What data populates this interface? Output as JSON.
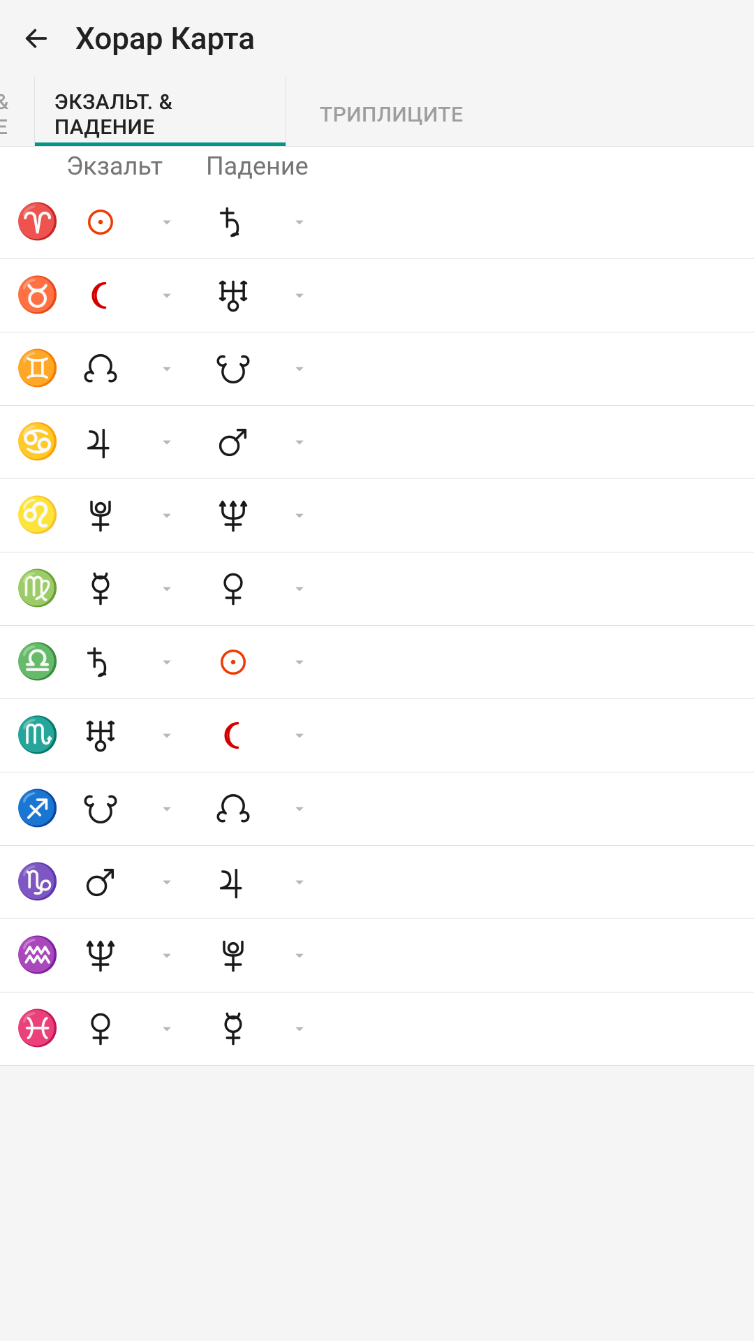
{
  "header": {
    "title": "Хорар Карта"
  },
  "tabs": {
    "left": "ТЕЛЬ &\nНАНИЕ",
    "center": "ЭКЗАЛЬТ. &\nПАДЕНИЕ",
    "right": "ТРИПЛИЦИТЕ"
  },
  "columns": {
    "exalt": "Экзальт",
    "fall": "Падение"
  },
  "rows": [
    {
      "sign": "aries",
      "sign_glyph": "♈",
      "sign_color": "c-red",
      "exalt": "sun",
      "exalt_color": "c-red-sun",
      "fall": "saturn",
      "fall_color": "c-black"
    },
    {
      "sign": "taurus",
      "sign_glyph": "♉",
      "sign_color": "c-green",
      "exalt": "moon",
      "exalt_color": "c-red-bright",
      "fall": "uranus",
      "fall_color": "c-black"
    },
    {
      "sign": "gemini",
      "sign_glyph": "♊",
      "sign_color": "c-blue",
      "exalt": "north-node",
      "exalt_color": "c-black",
      "fall": "south-node",
      "fall_color": "c-black"
    },
    {
      "sign": "cancer",
      "sign_glyph": "♋",
      "sign_color": "c-teal",
      "exalt": "jupiter",
      "exalt_color": "c-black",
      "fall": "mars",
      "fall_color": "c-black"
    },
    {
      "sign": "leo",
      "sign_glyph": "♌",
      "sign_color": "c-red",
      "exalt": "pluto",
      "exalt_color": "c-black",
      "fall": "neptune",
      "fall_color": "c-black"
    },
    {
      "sign": "virgo",
      "sign_glyph": "♍",
      "sign_color": "c-green",
      "exalt": "mercury",
      "exalt_color": "c-black",
      "fall": "venus",
      "fall_color": "c-black"
    },
    {
      "sign": "libra",
      "sign_glyph": "♎",
      "sign_color": "c-blue",
      "exalt": "saturn",
      "exalt_color": "c-black",
      "fall": "sun",
      "fall_color": "c-red-sun"
    },
    {
      "sign": "scorpio",
      "sign_glyph": "♏",
      "sign_color": "c-teal2",
      "exalt": "uranus",
      "exalt_color": "c-black",
      "fall": "moon",
      "fall_color": "c-red-bright"
    },
    {
      "sign": "sagittarius",
      "sign_glyph": "♐",
      "sign_color": "c-red-bright",
      "exalt": "south-node",
      "exalt_color": "c-black",
      "fall": "north-node",
      "fall_color": "c-black"
    },
    {
      "sign": "capricorn",
      "sign_glyph": "♑",
      "sign_color": "c-green",
      "exalt": "mars",
      "exalt_color": "c-black",
      "fall": "jupiter",
      "fall_color": "c-black"
    },
    {
      "sign": "aquarius",
      "sign_glyph": "♒",
      "sign_color": "c-blue",
      "exalt": "neptune",
      "exalt_color": "c-black",
      "fall": "pluto",
      "fall_color": "c-black"
    },
    {
      "sign": "pisces",
      "sign_glyph": "♓",
      "sign_color": "c-teal",
      "exalt": "venus",
      "exalt_color": "c-black",
      "fall": "mercury",
      "fall_color": "c-black"
    }
  ],
  "planet_glyphs": {
    "sun": "☉",
    "moon": "☽",
    "mercury": "☿",
    "venus": "♀",
    "mars": "♂",
    "jupiter": "♃",
    "saturn": "♄",
    "uranus": "♅",
    "neptune": "♆",
    "pluto": "♇",
    "north-node": "☊",
    "south-node": "☋"
  }
}
